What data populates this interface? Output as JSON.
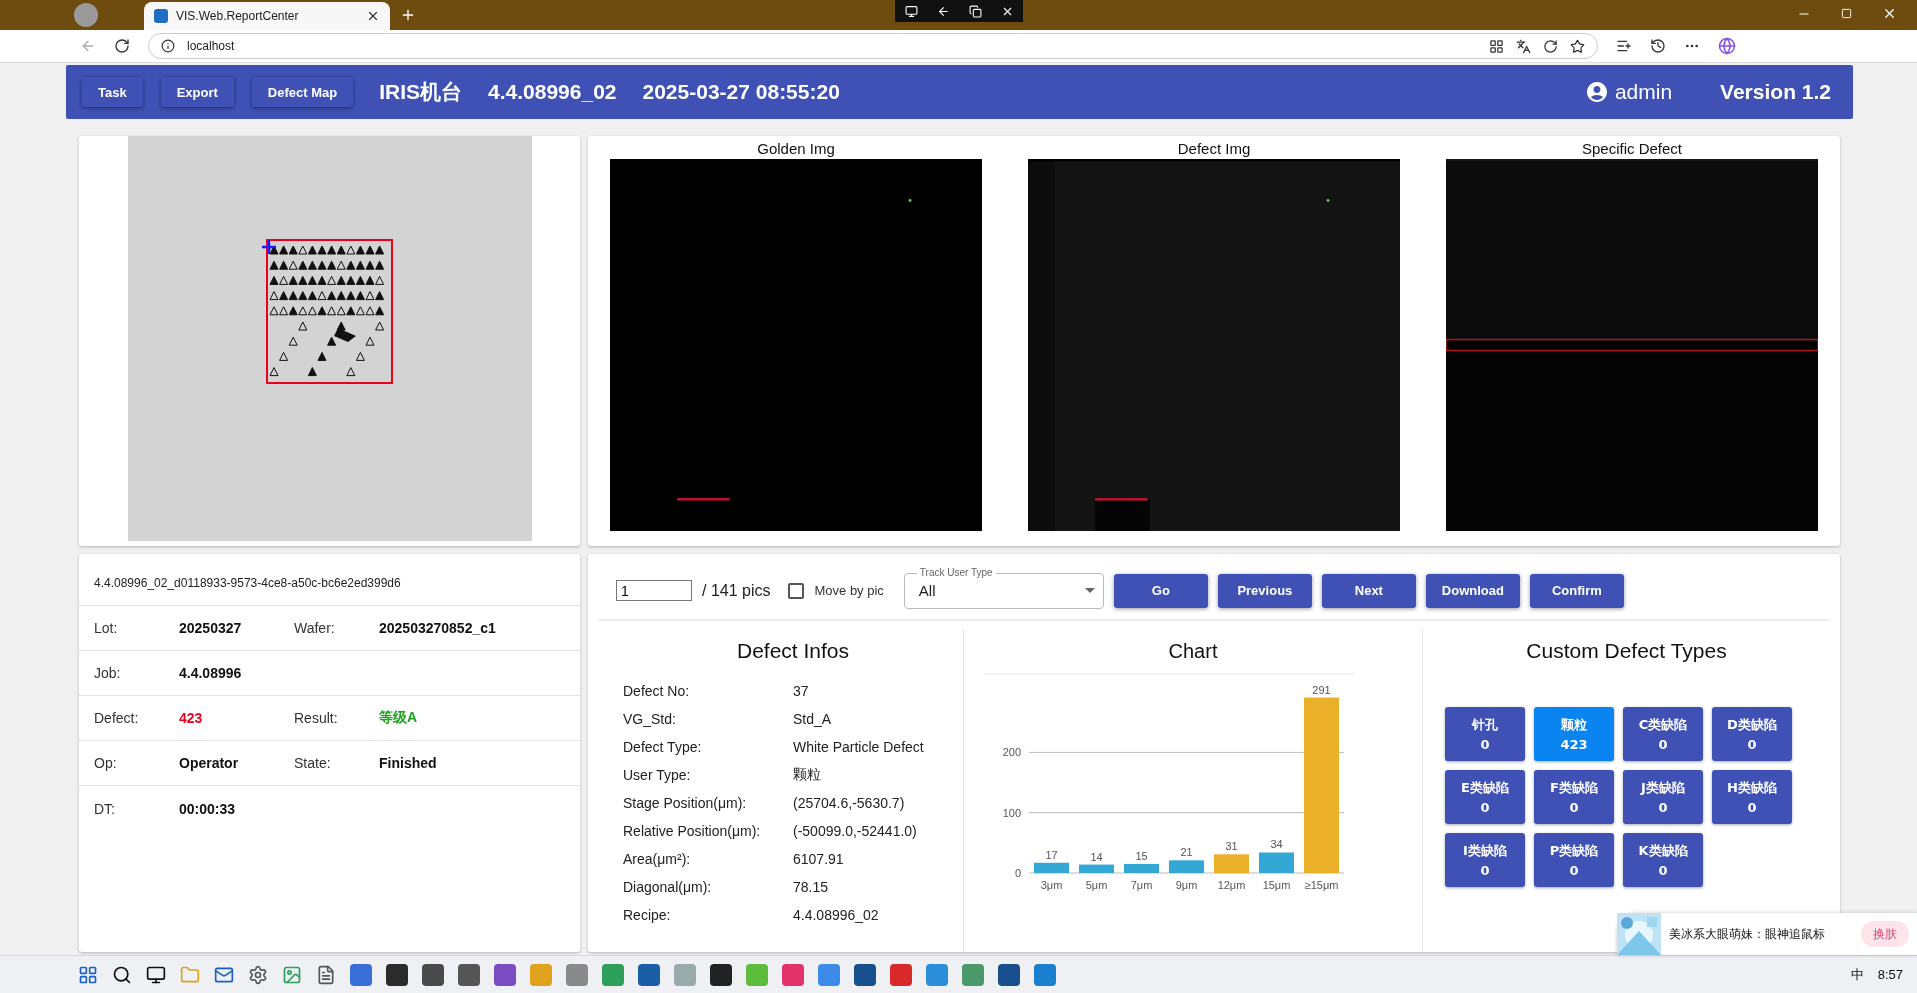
{
  "browser": {
    "tab_title": "VIS.Web.ReportCenter",
    "address": "localhost"
  },
  "header": {
    "buttons": [
      "Task",
      "Export",
      "Defect Map"
    ],
    "machine": "IRIS机台",
    "recipe": "4.4.08996_02",
    "datetime": "2025-03-27 08:55:20",
    "user": "admin",
    "version": "Version 1.2"
  },
  "images": [
    {
      "title": "Golden Img",
      "kind": "picture"
    },
    {
      "title": "Defect Img",
      "kind": "picture"
    },
    {
      "title": "Specific Defect",
      "kind": "picture"
    }
  ],
  "summary": {
    "id": "4.4.08996_02_d0118933-9573-4ce8-a50c-bc6e2ed399d6",
    "rows": [
      {
        "fields": [
          {
            "label": "Lot:",
            "value": "20250327"
          },
          {
            "label": "Wafer:",
            "value": "202503270852_c1"
          }
        ]
      },
      {
        "fields": [
          {
            "label": "Job:",
            "value": "4.4.08996"
          }
        ]
      },
      {
        "fields": [
          {
            "label": "Defect:",
            "value": "423",
            "color": "#e8001c"
          },
          {
            "label": "Result:",
            "value": "等级A",
            "color": "#1aa51a"
          }
        ]
      },
      {
        "fields": [
          {
            "label": "Op:",
            "value": "Operator"
          },
          {
            "label": "State:",
            "value": "Finished"
          }
        ]
      },
      {
        "fields": [
          {
            "label": "DT:",
            "value": "00:00:33"
          }
        ]
      }
    ]
  },
  "navigator": {
    "page": "1",
    "total": "/ 141 pics",
    "move_by_pic": {
      "label": "Move by pic",
      "checked": false
    },
    "track_user_type": {
      "label": "Track User Type",
      "value": "All"
    },
    "buttons": [
      "Go",
      "Previous",
      "Next",
      "Download",
      "Confirm"
    ]
  },
  "defect_infos": {
    "title": "Defect Infos",
    "rows": [
      {
        "label": "Defect No:",
        "value": "37"
      },
      {
        "label": "VG_Std:",
        "value": "Std_A"
      },
      {
        "label": "Defect Type:",
        "value": "White Particle Defect"
      },
      {
        "label": "User Type:",
        "value": "颗粒"
      },
      {
        "label": "Stage Position(μm):",
        "value": "(25704.6,-5630.7)"
      },
      {
        "label": "Relative Position(μm):",
        "value": "(-50099.0,-52441.0)"
      },
      {
        "label": "Area(μm²):",
        "value": "6107.91"
      },
      {
        "label": "Diagonal(μm):",
        "value": "78.15"
      },
      {
        "label": "Recipe:",
        "value": "4.4.08996_02"
      }
    ]
  },
  "chart": {
    "title": "Chart",
    "chart_data": {
      "type": "bar",
      "categories": [
        "3μm",
        "5μm",
        "7μm",
        "9μm",
        "12μm",
        "15μm",
        "≥15μm"
      ],
      "data_labels": true,
      "ylim": [
        0,
        330
      ],
      "yticks": [
        0,
        100,
        200
      ],
      "values": [
        17,
        14,
        15,
        21,
        31,
        34,
        291
      ],
      "colors": [
        "#34a8d4",
        "#34a8d4",
        "#34a8d4",
        "#34a8d4",
        "#eab02a",
        "#34a8d4",
        "#eab02a"
      ]
    }
  },
  "custom_defect_types": {
    "title": "Custom Defect Types",
    "items": [
      {
        "label": "针孔",
        "count": "0",
        "selected": false
      },
      {
        "label": "颗粒",
        "count": "423",
        "selected": true
      },
      {
        "label": "C类缺陷",
        "count": "0",
        "selected": false
      },
      {
        "label": "D类缺陷",
        "count": "0",
        "selected": false
      },
      {
        "label": "E类缺陷",
        "count": "0",
        "selected": false
      },
      {
        "label": "F类缺陷",
        "count": "0",
        "selected": false
      },
      {
        "label": "J类缺陷",
        "count": "0",
        "selected": false
      },
      {
        "label": "H类缺陷",
        "count": "0",
        "selected": false
      },
      {
        "label": "I类缺陷",
        "count": "0",
        "selected": false
      },
      {
        "label": "P类缺陷",
        "count": "0",
        "selected": false
      },
      {
        "label": "K类缺陷",
        "count": "0",
        "selected": false
      }
    ]
  },
  "popup": {
    "text": "美冰系大眼萌妹：眼神追鼠标",
    "button": "换肤"
  },
  "taskbar": {
    "ime": "中",
    "time": "8:57"
  }
}
